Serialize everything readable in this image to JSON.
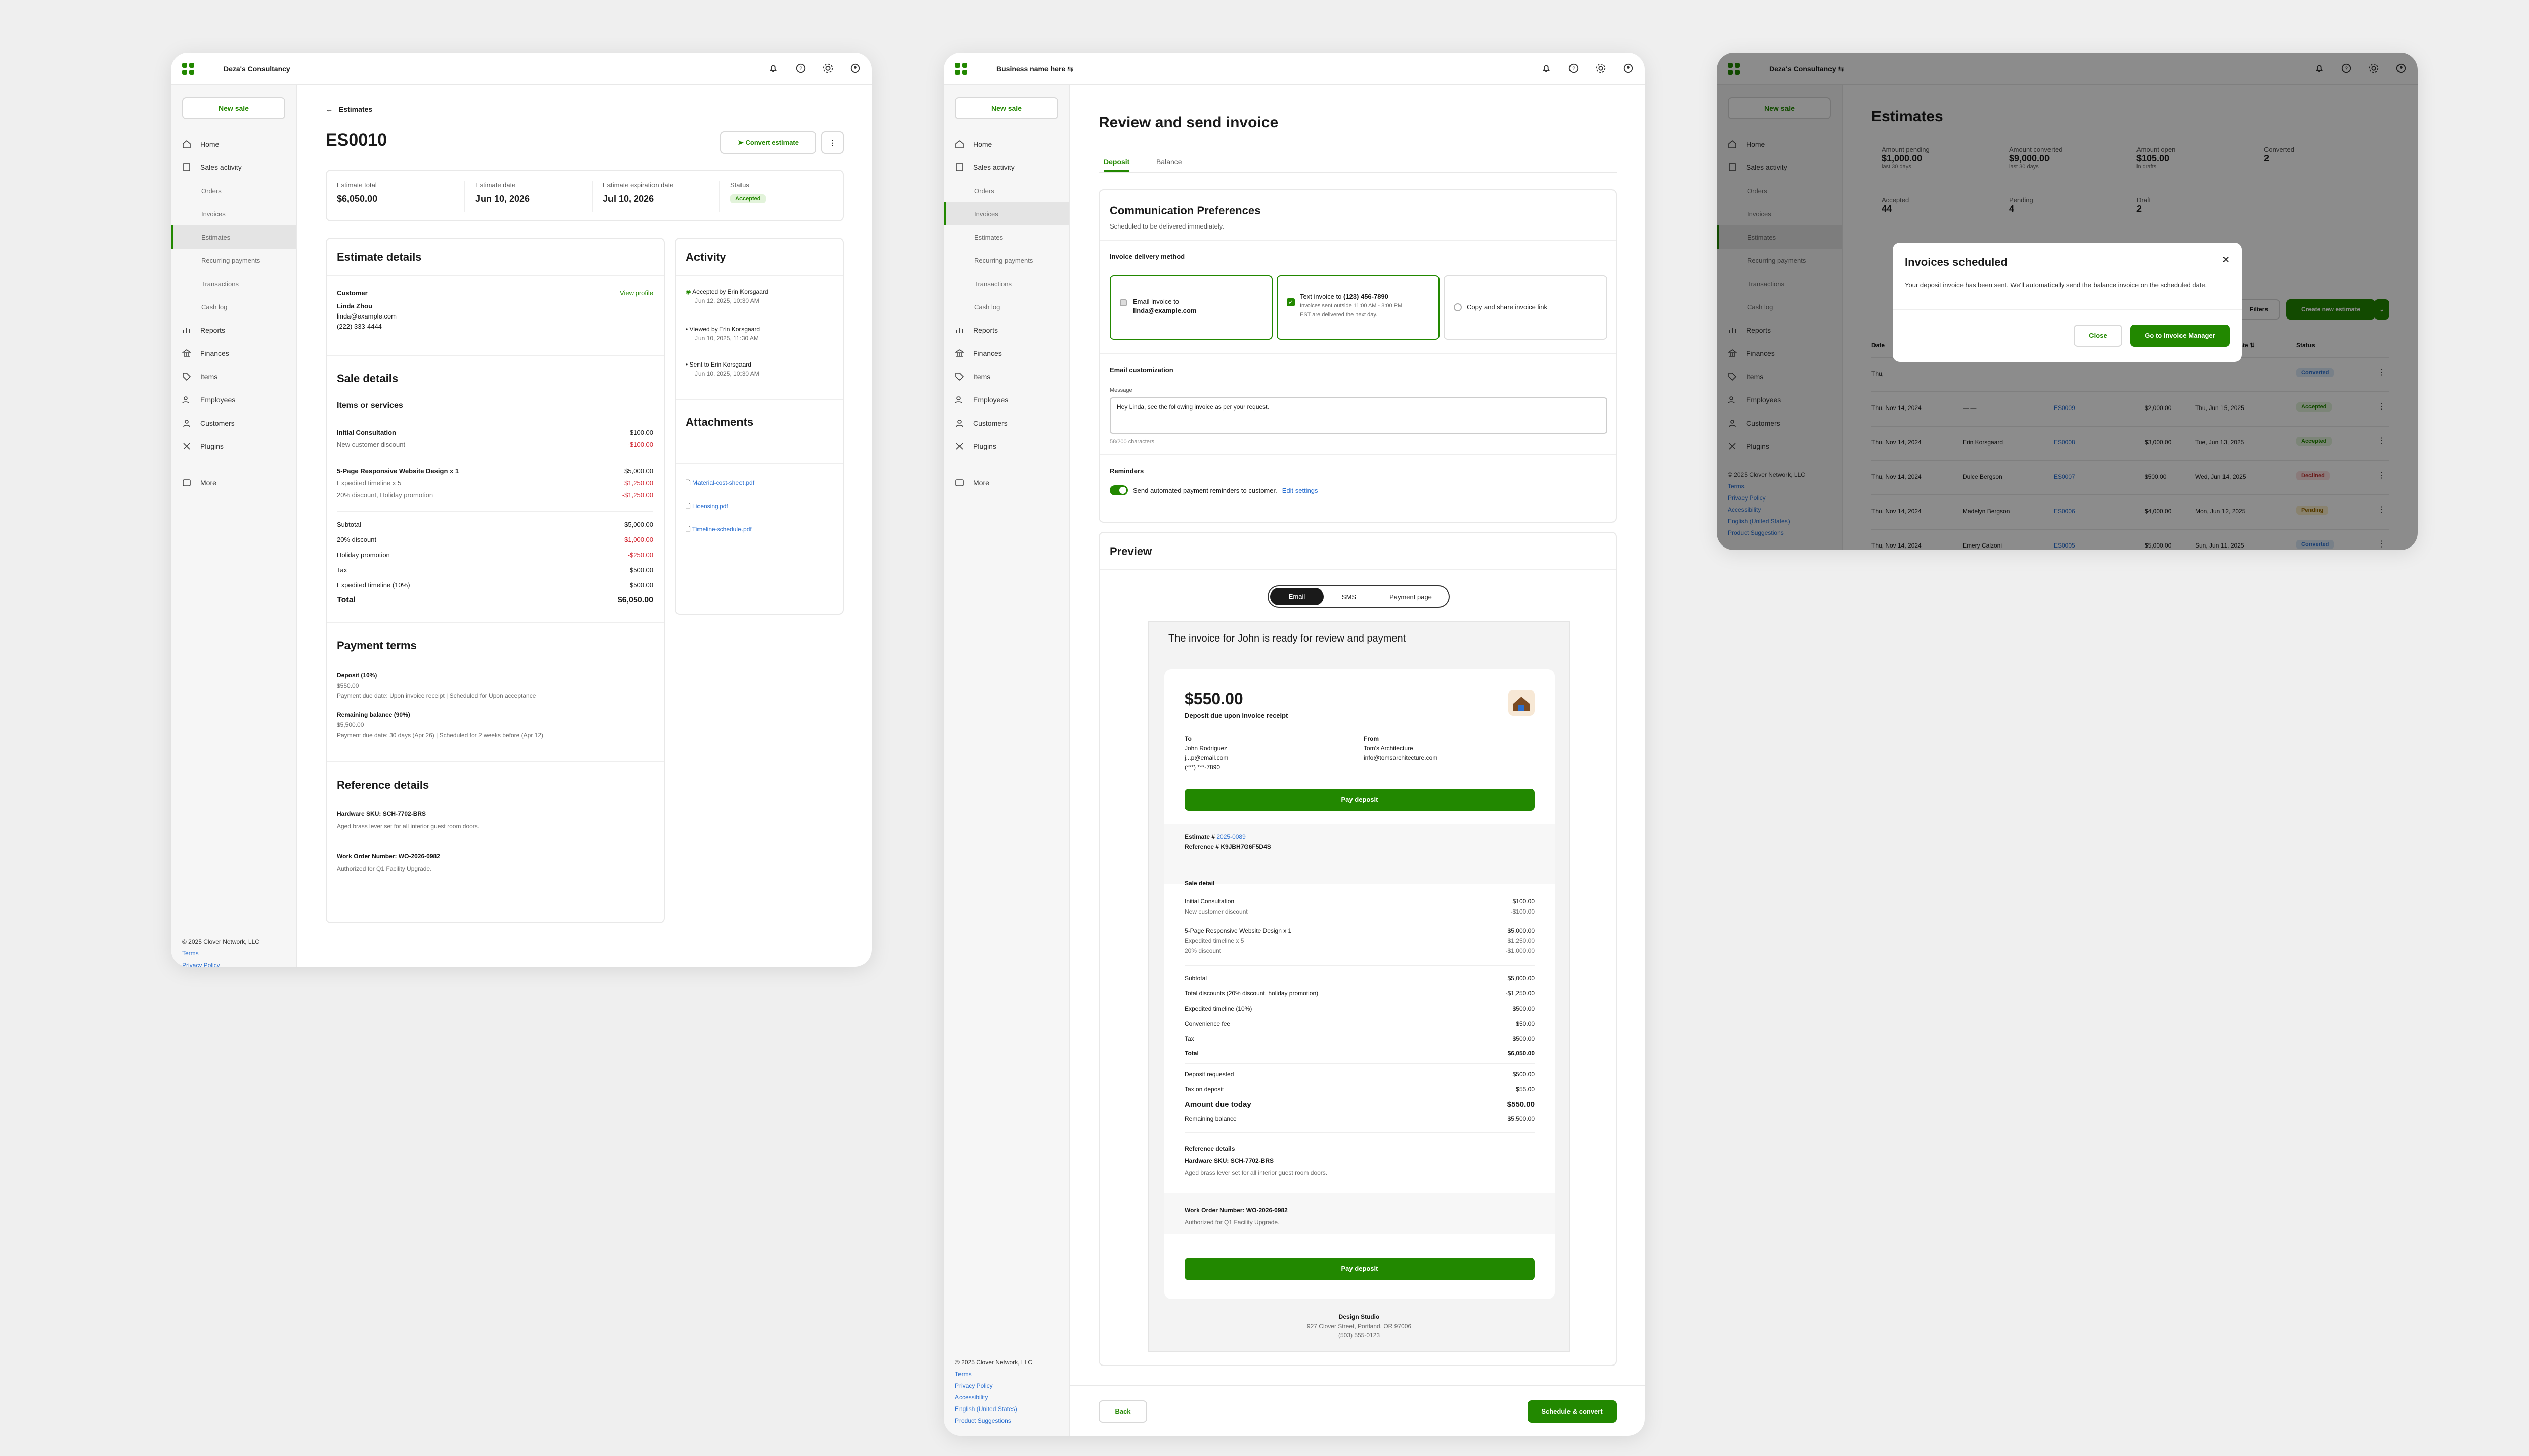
{
  "common": {
    "new_sale": "New sale",
    "nav": [
      "Home",
      "Sales activity",
      "Orders",
      "Invoices",
      "Estimates",
      "Recurring payments",
      "Transactions",
      "Cash log",
      "Reports",
      "Finances",
      "Items",
      "Employees",
      "Customers",
      "Plugins",
      "More"
    ],
    "footer": {
      "copyright": "© 2025 Clover Network, LLC",
      "links": [
        "Terms",
        "Privacy Policy",
        "Accessibility",
        "English (United States)",
        "Product Suggestions"
      ]
    },
    "accent": "#228800"
  },
  "estimate": {
    "business": "Deza's Consultancy",
    "back": "Estimates",
    "id": "ES0010",
    "convert": "Convert estimate",
    "summary": [
      {
        "label": "Estimate total",
        "value": "$6,050.00"
      },
      {
        "label": "Estimate date",
        "value": "Jun 10, 2026"
      },
      {
        "label": "Estimate expiration date",
        "value": "Jul 10, 2026"
      },
      {
        "label": "Status",
        "value": "Accepted"
      }
    ],
    "details_title": "Estimate details",
    "customer_label": "Customer",
    "view_profile": "View profile",
    "customer_name": "Linda Zhou",
    "customer_email": "linda@example.com",
    "customer_phone": "(222) 333-4444",
    "sale_title": "Sale details",
    "items_title": "Items or services",
    "items": [
      {
        "name": "Initial Consultation",
        "amount": "$100.00",
        "bold": true
      },
      {
        "name": "New customer discount",
        "amount": "-$100.00",
        "neg": true
      },
      {
        "name": "5-Page Responsive Website Design x 1",
        "amount": "$5,000.00",
        "bold": true
      },
      {
        "name": "Expedited timeline x 5",
        "amount": "$1,250.00"
      },
      {
        "name": "20% discount, Holiday promotion",
        "amount": "-$1,250.00",
        "neg": true
      }
    ],
    "totals": [
      {
        "name": "Subtotal",
        "amount": "$5,000.00"
      },
      {
        "name": "20% discount",
        "amount": "-$1,000.00",
        "neg": true
      },
      {
        "name": "Holiday promotion",
        "amount": "-$250.00",
        "neg": true
      },
      {
        "name": "Tax",
        "amount": "$500.00"
      },
      {
        "name": "Expedited timeline (10%)",
        "amount": "$500.00"
      }
    ],
    "total_label": "Total",
    "total_value": "$6,050.00",
    "terms_title": "Payment terms",
    "terms": [
      {
        "title": "Deposit (10%)",
        "amount": "$550.00",
        "note": "Payment due date: Upon invoice receipt | Scheduled for Upon acceptance"
      },
      {
        "title": "Remaining balance (90%)",
        "amount": "$5,500.00",
        "note": "Payment due date: 30 days (Apr 26) | Scheduled for 2 weeks before (Apr 12)"
      }
    ],
    "ref_title": "Reference details",
    "refs": [
      {
        "title": "Hardware SKU: SCH-7702-BRS",
        "note": "Aged brass lever set for all interior guest room doors."
      },
      {
        "title": "Work Order Number: WO-2026-0982",
        "note": "Authorized for Q1 Facility Upgrade."
      }
    ],
    "activity_title": "Activity",
    "activity": [
      {
        "text": "Accepted by Erin Korsgaard",
        "time": "Jun 12, 2025, 10:30 AM"
      },
      {
        "text": "Viewed by Erin Korsgaard",
        "time": "Jun 10, 2025, 11:30 AM"
      },
      {
        "text": "Sent to Erin Korsgaard",
        "time": "Jun 10, 2025, 10:30 AM"
      }
    ],
    "attach_title": "Attachments",
    "attachments": [
      "Material-cost-sheet.pdf",
      "Licensing.pdf",
      "Timeline-schedule.pdf"
    ]
  },
  "invoice": {
    "business": "Business name here",
    "title": "Review and send invoice",
    "tabs": [
      "Deposit",
      "Balance"
    ],
    "comm_title": "Communication Preferences",
    "comm_sub": "Scheduled to be delivered immediately.",
    "method_label": "Invoice delivery method",
    "methods": [
      {
        "line1": "Email invoice to",
        "line2": "linda@example.com"
      },
      {
        "line1": "Text invoice to",
        "line2": "(123) 456-7890",
        "note1": "Invoices sent outside 11:00 AM - 8:00 PM",
        "note2": "EST are delivered the next day."
      },
      {
        "line1": "Copy and share invoice link",
        "line2": ""
      }
    ],
    "custom_label": "Email customization",
    "message_label": "Message",
    "message": "Hey Linda, see the following invoice as per your request.",
    "chars": "58/200 characters",
    "reminders_label": "Reminders",
    "reminders_text": "Send automated payment reminders to customer.",
    "edit_settings": "Edit settings",
    "preview_title": "Preview",
    "preview_tabs": [
      "Email",
      "SMS",
      "Payment page"
    ],
    "email_heading": "The invoice for John is ready for review and payment",
    "amount": "$550.00",
    "amount_sub": "Deposit due upon invoice receipt",
    "to_label": "To",
    "to_lines": [
      "John Rodriguez",
      "j...p@email.com",
      "(***) ***-7890"
    ],
    "from_label": "From",
    "from_lines": [
      "Tom's Architecture",
      "info@tomsarchitecture.com"
    ],
    "pay": "Pay deposit",
    "estimate_no_label": "Estimate #",
    "estimate_no": "2025-0089",
    "reference_no": "Reference # K9JBH7G6F5D4S",
    "sale_detail": "Sale detail",
    "lines1": [
      {
        "name": "Initial Consultation",
        "amount": "$100.00"
      },
      {
        "name": "New customer discount",
        "amount": "-$100.00",
        "muted": true
      },
      {
        "name": "5-Page Responsive Website Design x 1",
        "amount": "$5,000.00"
      },
      {
        "name": "Expedited timeline x 5",
        "amount": "$1,250.00",
        "muted": true
      },
      {
        "name": "20% discount",
        "amount": "-$1,000.00",
        "muted": true
      }
    ],
    "lines2": [
      {
        "name": "Subtotal",
        "amount": "$5,000.00"
      },
      {
        "name": "Total discounts (20% discount, holiday promotion)",
        "amount": "-$1,250.00"
      },
      {
        "name": "Expedited timeline (10%)",
        "amount": "$500.00"
      },
      {
        "name": "Convenience fee",
        "amount": "$50.00"
      },
      {
        "name": "Tax",
        "amount": "$500.00"
      },
      {
        "name": "Total",
        "amount": "$6,050.00",
        "bold": true
      }
    ],
    "lines3": [
      {
        "name": "Deposit requested",
        "amount": "$500.00"
      },
      {
        "name": "Tax on deposit",
        "amount": "$55.00"
      },
      {
        "name": "Amount due today",
        "amount": "$550.00",
        "big": true
      },
      {
        "name": "Remaining balance",
        "amount": "$5,500.00"
      }
    ],
    "ref_title": "Reference details",
    "ref1_title": "Hardware SKU: SCH-7702-BRS",
    "ref1_note": "Aged brass lever set for all interior guest room doors.",
    "ref2_title": "Work Order Number: WO-2026-0982",
    "ref2_note": "Authorized for Q1 Facility Upgrade.",
    "studio": "Design Studio",
    "studio_addr": "927 Clover Street, Portland, OR 97006",
    "studio_phone": "(503) 555-0123",
    "back_btn": "Back",
    "submit_btn": "Schedule & convert"
  },
  "estimates_list": {
    "business": "Deza's Consultancy",
    "title": "Estimates",
    "stats": [
      {
        "label": "Amount pending",
        "value": "$1,000.00",
        "sub": "last 30 days"
      },
      {
        "label": "Amount converted",
        "value": "$9,000.00",
        "sub": "last 30 days"
      },
      {
        "label": "Amount open",
        "value": "$105.00",
        "sub": "in drafts"
      },
      {
        "label": "Converted",
        "value": "2",
        "sub": ""
      },
      {
        "label": "Accepted",
        "value": "44",
        "sub": ""
      },
      {
        "label": "Pending",
        "value": "4",
        "sub": ""
      },
      {
        "label": "Draft",
        "value": "2",
        "sub": ""
      }
    ],
    "filters": "Filters",
    "create": "Create new estimate",
    "col_date": "Date",
    "col_exp": "date",
    "col_status": "Status",
    "rows": [
      {
        "date": "Thu,",
        "customer": "",
        "id": "",
        "amount": "",
        "exp": "",
        "status": "Converted",
        "kind": "conv"
      },
      {
        "date": "Thu, Nov 14, 2024",
        "customer": "— —",
        "id": "ES0009",
        "amount": "$2,000.00",
        "exp": "Thu, Jun 15, 2025",
        "status": "Accepted",
        "kind": "acc"
      },
      {
        "date": "Thu, Nov 14, 2024",
        "customer": "Erin Korsgaard",
        "id": "ES0008",
        "amount": "$3,000.00",
        "exp": "Tue, Jun 13, 2025",
        "status": "Accepted",
        "kind": "acc"
      },
      {
        "date": "Thu, Nov 14, 2024",
        "customer": "Dulce Bergson",
        "id": "ES0007",
        "amount": "$500.00",
        "exp": "Wed, Jun 14, 2025",
        "status": "Declined",
        "kind": "dec"
      },
      {
        "date": "Thu, Nov 14, 2024",
        "customer": "Madelyn Bergson",
        "id": "ES0006",
        "amount": "$4,000.00",
        "exp": "Mon, Jun 12, 2025",
        "status": "Pending",
        "kind": "pend"
      },
      {
        "date": "Thu, Nov 14, 2024",
        "customer": "Emery Calzoni",
        "id": "ES0005",
        "amount": "$5,000.00",
        "exp": "Sun, Jun 11, 2025",
        "status": "Converted",
        "kind": "conv"
      }
    ],
    "modal": {
      "title": "Invoices scheduled",
      "body": "Your deposit invoice has been sent. We'll automatically send the balance invoice on the scheduled date.",
      "close": "Close",
      "go": "Go to Invoice Manager"
    }
  }
}
